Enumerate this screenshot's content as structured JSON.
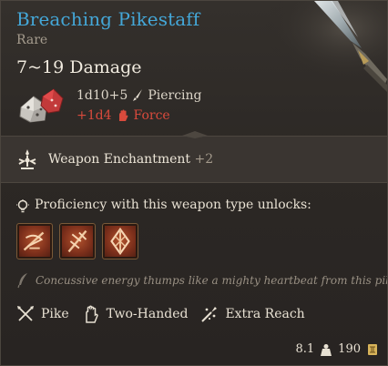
{
  "item": {
    "name": "Breaching Pikestaff",
    "rarity": "Rare",
    "damage_total": "7~19 Damage",
    "damage_base": "1d10+5",
    "damage_base_type": "Piercing",
    "damage_bonus": "+1d4",
    "damage_bonus_type": "Force"
  },
  "enchantment": {
    "label": "Weapon Enchantment",
    "value": "+2"
  },
  "proficiency": {
    "label": "Proficiency with this weapon type unlocks:",
    "actions": [
      {
        "icon": "pike-action-1-icon"
      },
      {
        "icon": "pike-action-2-icon"
      },
      {
        "icon": "pike-action-3-icon"
      }
    ]
  },
  "flavor_text": "Concussive energy thumps like a mighty heartbeat from this pike.",
  "properties": [
    {
      "label": "Pike",
      "icon": "crossed-pikes-icon"
    },
    {
      "label": "Two-Handed",
      "icon": "hand-icon"
    },
    {
      "label": "Extra Reach",
      "icon": "reach-icon"
    }
  ],
  "footer": {
    "weight": "8.1",
    "price": "190"
  },
  "colors": {
    "title": "#44a7d8",
    "force": "#d94a3c",
    "gold": "#d8b45a"
  }
}
